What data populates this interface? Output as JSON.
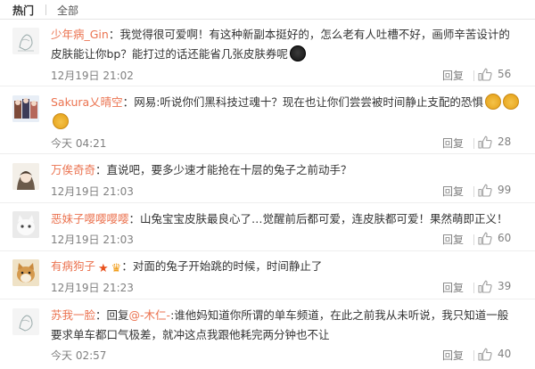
{
  "tabs": {
    "hot": "热门",
    "all": "全部"
  },
  "reply_label": "回复",
  "comments": [
    {
      "username": "少年病_Gin",
      "colon": "：",
      "text": "我觉得很可爱啊！有这种新副本挺好的，怎么老有人吐槽不好，画师辛苦设计的皮肤能让你bp？能打过的话还能省几张皮肤券呢",
      "time": "12月19日 21:02",
      "likes": "56",
      "avatar_icon": "sketch-avatar",
      "emoji": "fox-emoji"
    },
    {
      "username": "Sakura乂晴空",
      "colon": "：",
      "text": "网易:听说你们黑科技过魂十？现在也让你们尝尝被时间静止支配的恐惧",
      "time": "今天 04:21",
      "likes": "28",
      "avatar_icon": "character-avatar",
      "emoji": "dog-emoji"
    },
    {
      "username": "万俟奇奇",
      "colon": "：",
      "text": "直说吧，要多少速才能抢在十层的兔子之前动手？",
      "time": "12月19日 21:03",
      "likes": "99",
      "avatar_icon": "anime-avatar"
    },
    {
      "username": "恶妹子嘤嘤嘤嘤",
      "colon": "：",
      "text": "山兔宝宝皮肤最良心了…觉醒前后都可爱，连皮肤都可爱！果然萌即正义！",
      "time": "12月19日 21:03",
      "likes": "60",
      "avatar_icon": "cat-avatar"
    },
    {
      "username": "有病狗子",
      "colon": "：",
      "text": "对面的兔子开始跳的时候，时间静止了",
      "time": "12月19日 21:23",
      "likes": "39",
      "avatar_icon": "shiba-avatar"
    },
    {
      "username": "苏我一脸",
      "colon": "：",
      "reply_prefix": "回复",
      "reply_target": "@-木仁-",
      "text": ":谁他妈知道你所谓的单车频道，在此之前我从未听说，我只知道一般要求单车都口气极差，就冲这点我跟他耗完两分钟也不让",
      "time": "今天 02:57",
      "likes": "40",
      "avatar_icon": "sketch-avatar"
    }
  ],
  "colors": {
    "username": "#eb7350",
    "meta": "#808080",
    "text": "#333333"
  }
}
